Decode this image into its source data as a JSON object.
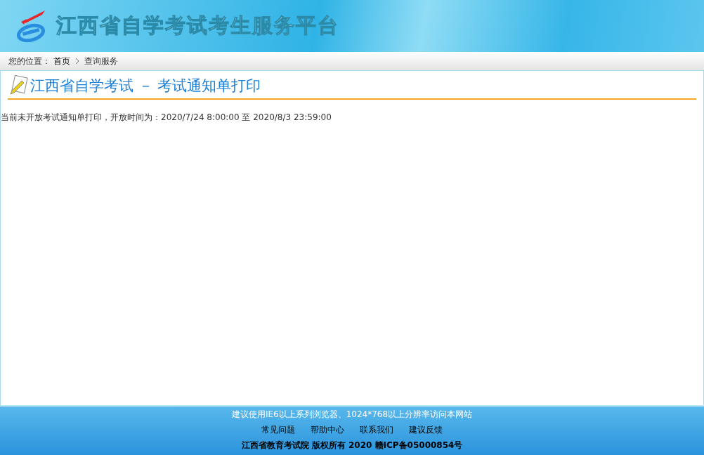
{
  "header": {
    "title": "江西省自学考试考生服务平台"
  },
  "breadcrumb": {
    "label": "您的位置：",
    "items": [
      {
        "text": "首页",
        "kind": "link"
      },
      {
        "text": "查询服务",
        "kind": "current"
      }
    ]
  },
  "page": {
    "title": "江西省自学考试 － 考试通知单打印",
    "notice": "当前未开放考试通知单打印，开放时间为：2020/7/24 8:00:00 至 2020/8/3 23:59:00"
  },
  "footer": {
    "advice": "建议使用IE6以上系列浏览器、1024*768以上分辨率访问本网站",
    "links": [
      "常见问题",
      "帮助中心",
      "联系我们",
      "建议反馈"
    ],
    "copyright": "江西省教育考试院 版权所有 2020 赣ICP备05000854号"
  }
}
